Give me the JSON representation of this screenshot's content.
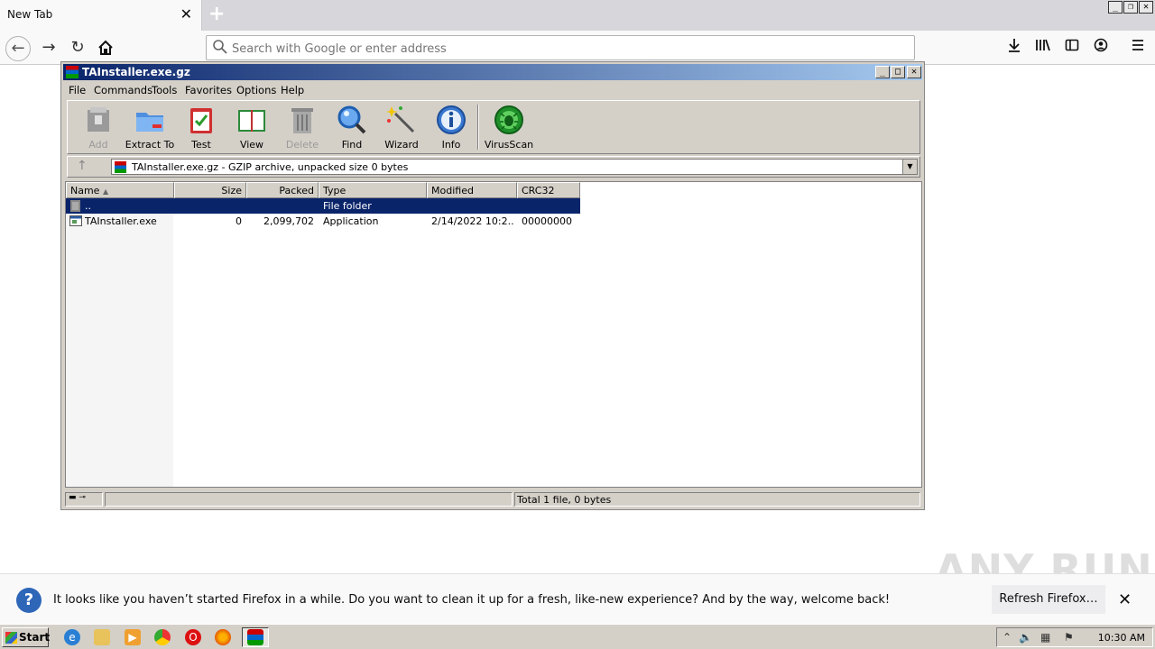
{
  "browser": {
    "tab_title": "New Tab",
    "tab_close": "✕",
    "new_tab": "+",
    "search_placeholder": "Search with Google or enter address",
    "window_controls": [
      "_",
      "❐",
      "✕"
    ],
    "icons": [
      "back-arrow-icon",
      "forward-arrow-icon",
      "reload-icon",
      "home-icon",
      "search-icon",
      "download-icon",
      "library-icon",
      "sidebar-icon",
      "account-icon",
      "menu-icon"
    ]
  },
  "rar": {
    "title": "TAInstaller.exe.gz",
    "title_buttons": [
      "_",
      "□",
      "✕"
    ],
    "menu": [
      "File",
      "Commands",
      "Tools",
      "Favorites",
      "Options",
      "Help"
    ],
    "tools": [
      {
        "label": "Add",
        "icon": "add-archive-icon",
        "disabled": true
      },
      {
        "label": "Extract To",
        "icon": "extract-folder-icon",
        "disabled": false
      },
      {
        "label": "Test",
        "icon": "test-clipboard-icon",
        "disabled": false
      },
      {
        "label": "View",
        "icon": "view-book-icon",
        "disabled": false
      },
      {
        "label": "Delete",
        "icon": "trash-icon",
        "disabled": true
      },
      {
        "label": "Find",
        "icon": "magnifier-icon",
        "disabled": false
      },
      {
        "label": "Wizard",
        "icon": "wand-icon",
        "disabled": false
      },
      {
        "label": "Info",
        "icon": "info-icon",
        "disabled": false
      },
      {
        "label": "VirusScan",
        "icon": "virus-icon",
        "disabled": false
      }
    ],
    "path_text": "TAInstaller.exe.gz - GZIP archive, unpacked size 0 bytes",
    "columns": [
      "Name",
      "Size",
      "Packed",
      "Type",
      "Modified",
      "CRC32"
    ],
    "rows": [
      {
        "name": "..",
        "size": "",
        "packed": "",
        "type": "File folder",
        "modified": "",
        "crc": "",
        "selected": true
      },
      {
        "name": "TAInstaller.exe",
        "size": "0",
        "packed": "2,099,702",
        "type": "Application",
        "modified": "2/14/2022 10:2...",
        "crc": "00000000",
        "selected": false
      }
    ],
    "status": "Total 1 file, 0 bytes"
  },
  "notification": {
    "text": "It looks like you haven’t started Firefox in a while. Do you want to clean it up for a fresh, like-new experience? And by the way, welcome back!",
    "button": "Refresh Firefox…",
    "close": "✕",
    "question_mark": "?"
  },
  "watermark": "ANY RUN",
  "taskbar": {
    "start": "Start",
    "clock": "10:30 AM",
    "apps": [
      "ie-icon",
      "explorer-icon",
      "media-player-icon",
      "chrome-icon",
      "opera-icon",
      "firefox-icon",
      "winrar-icon"
    ]
  }
}
